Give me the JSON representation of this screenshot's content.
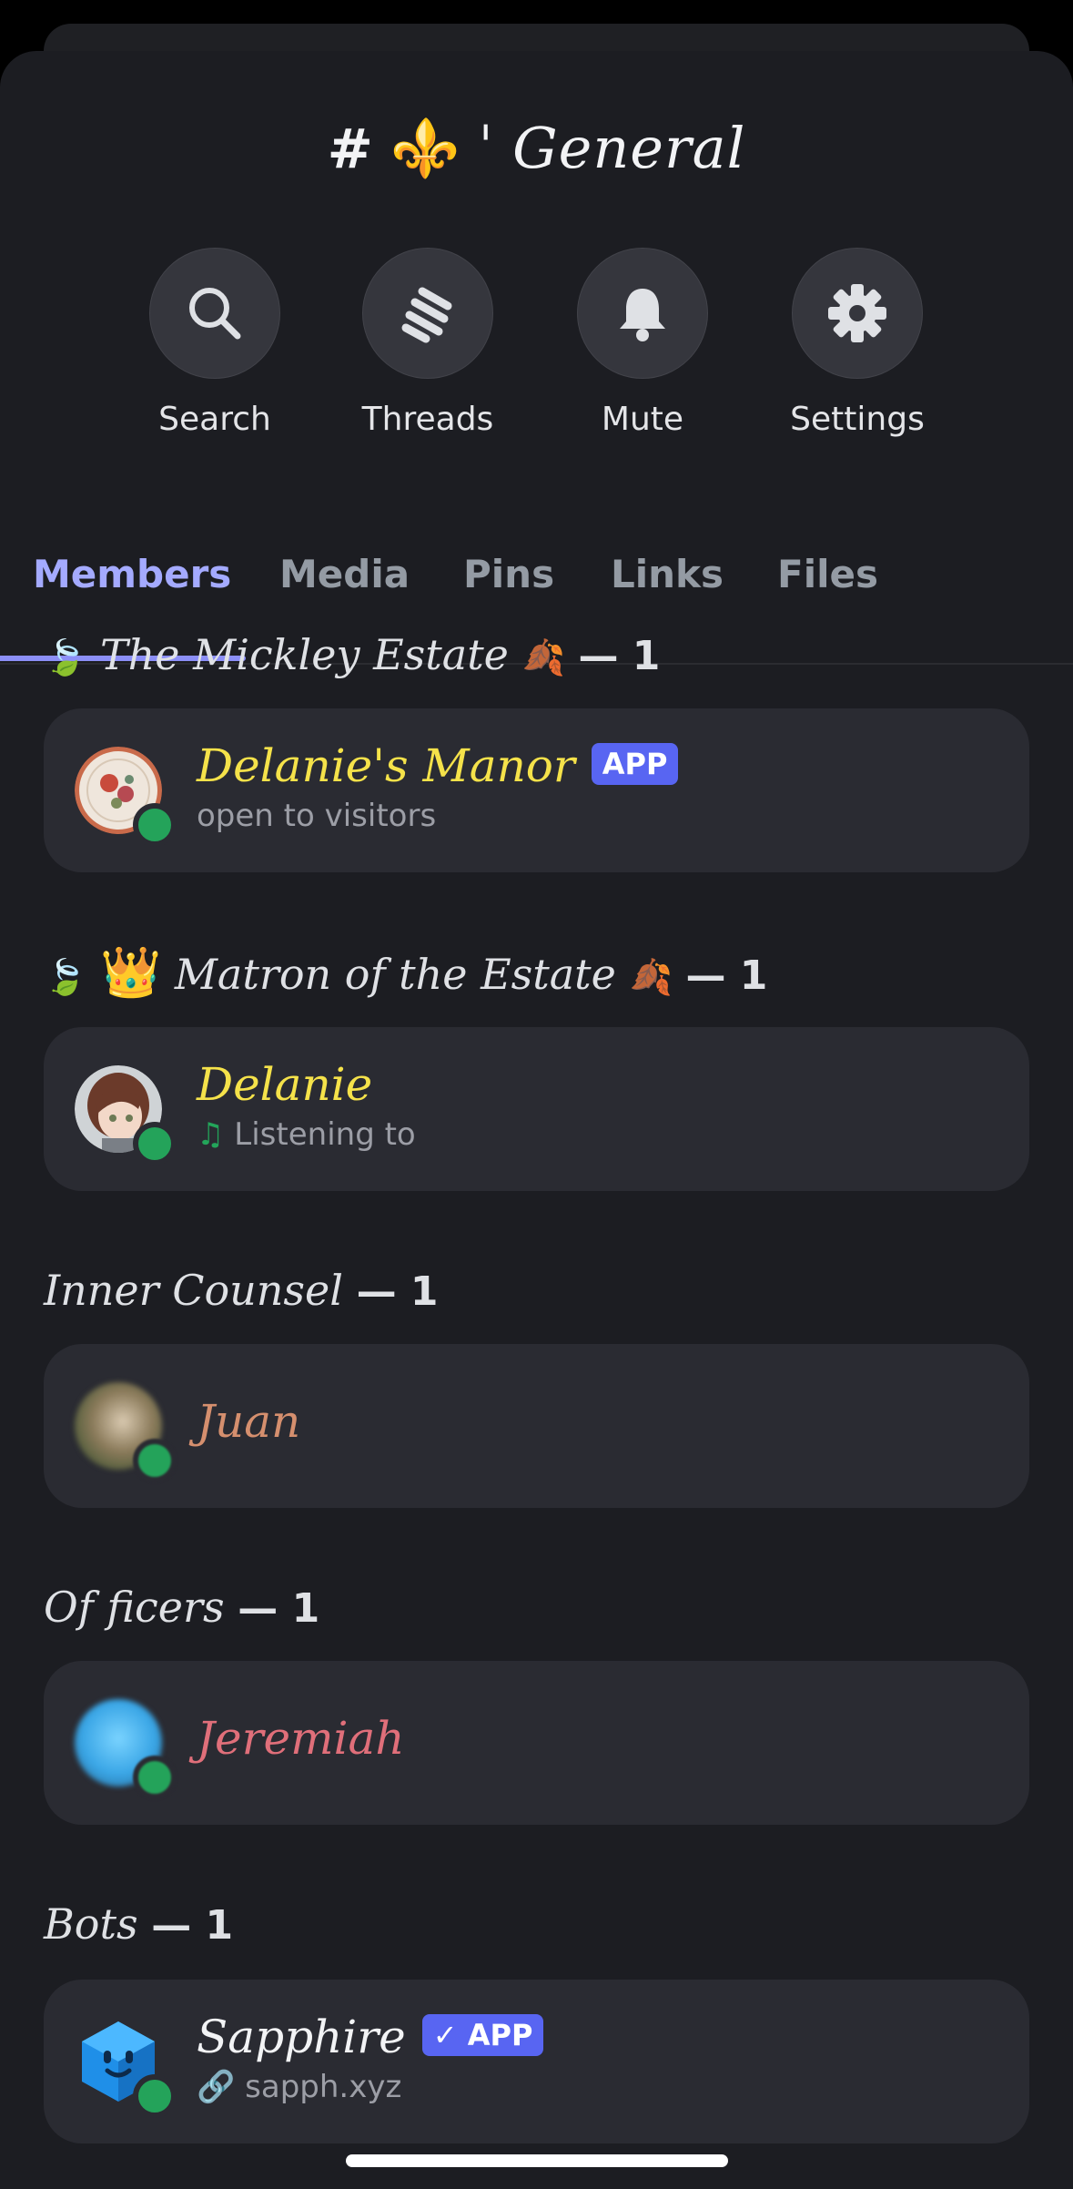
{
  "channel": {
    "hash": "#",
    "emoji": "⚜️",
    "tick": "ˈ",
    "name": "General"
  },
  "actions": [
    {
      "label": "Search",
      "icon": "search-icon"
    },
    {
      "label": "Threads",
      "icon": "threads-icon"
    },
    {
      "label": "Mute",
      "icon": "bell-icon"
    },
    {
      "label": "Settings",
      "icon": "gear-icon"
    }
  ],
  "tabs": [
    "Members",
    "Media",
    "Pins",
    "Links",
    "Files"
  ],
  "active_tab": "Members",
  "sections": [
    {
      "title": "The Mickley Estate",
      "count": "— 1",
      "leaf_left": "🍃",
      "leaf_right": "🍂"
    },
    {
      "title": "Matron of the Estate",
      "count": "— 1",
      "crown": "👑"
    },
    {
      "title": "Inner Counsel",
      "count": "— 1"
    },
    {
      "title": "Of ficers",
      "count": "— 1"
    },
    {
      "title": "Bots",
      "count": "— 1"
    }
  ],
  "members": [
    {
      "name": "Delanie's Manor",
      "badge": "APP",
      "status_text": "open to visitors",
      "name_color": "#f5e24a"
    },
    {
      "name": "Delanie",
      "activity_icon": "♫",
      "status_text": "Listening to",
      "name_color": "#f5e24a"
    },
    {
      "name": "Juan",
      "name_color": "#d58f6e"
    },
    {
      "name": "Jeremiah",
      "name_color": "#e06f7a"
    },
    {
      "name": "Sapphire",
      "badge": "✓ APP",
      "status_text": "sapph.xyz",
      "link_icon": "🔗",
      "name_color": "#f2f3f5"
    }
  ],
  "colors": {
    "online": "#24a35a",
    "accent": "#8c8ff7",
    "badge": "#5865f2"
  }
}
